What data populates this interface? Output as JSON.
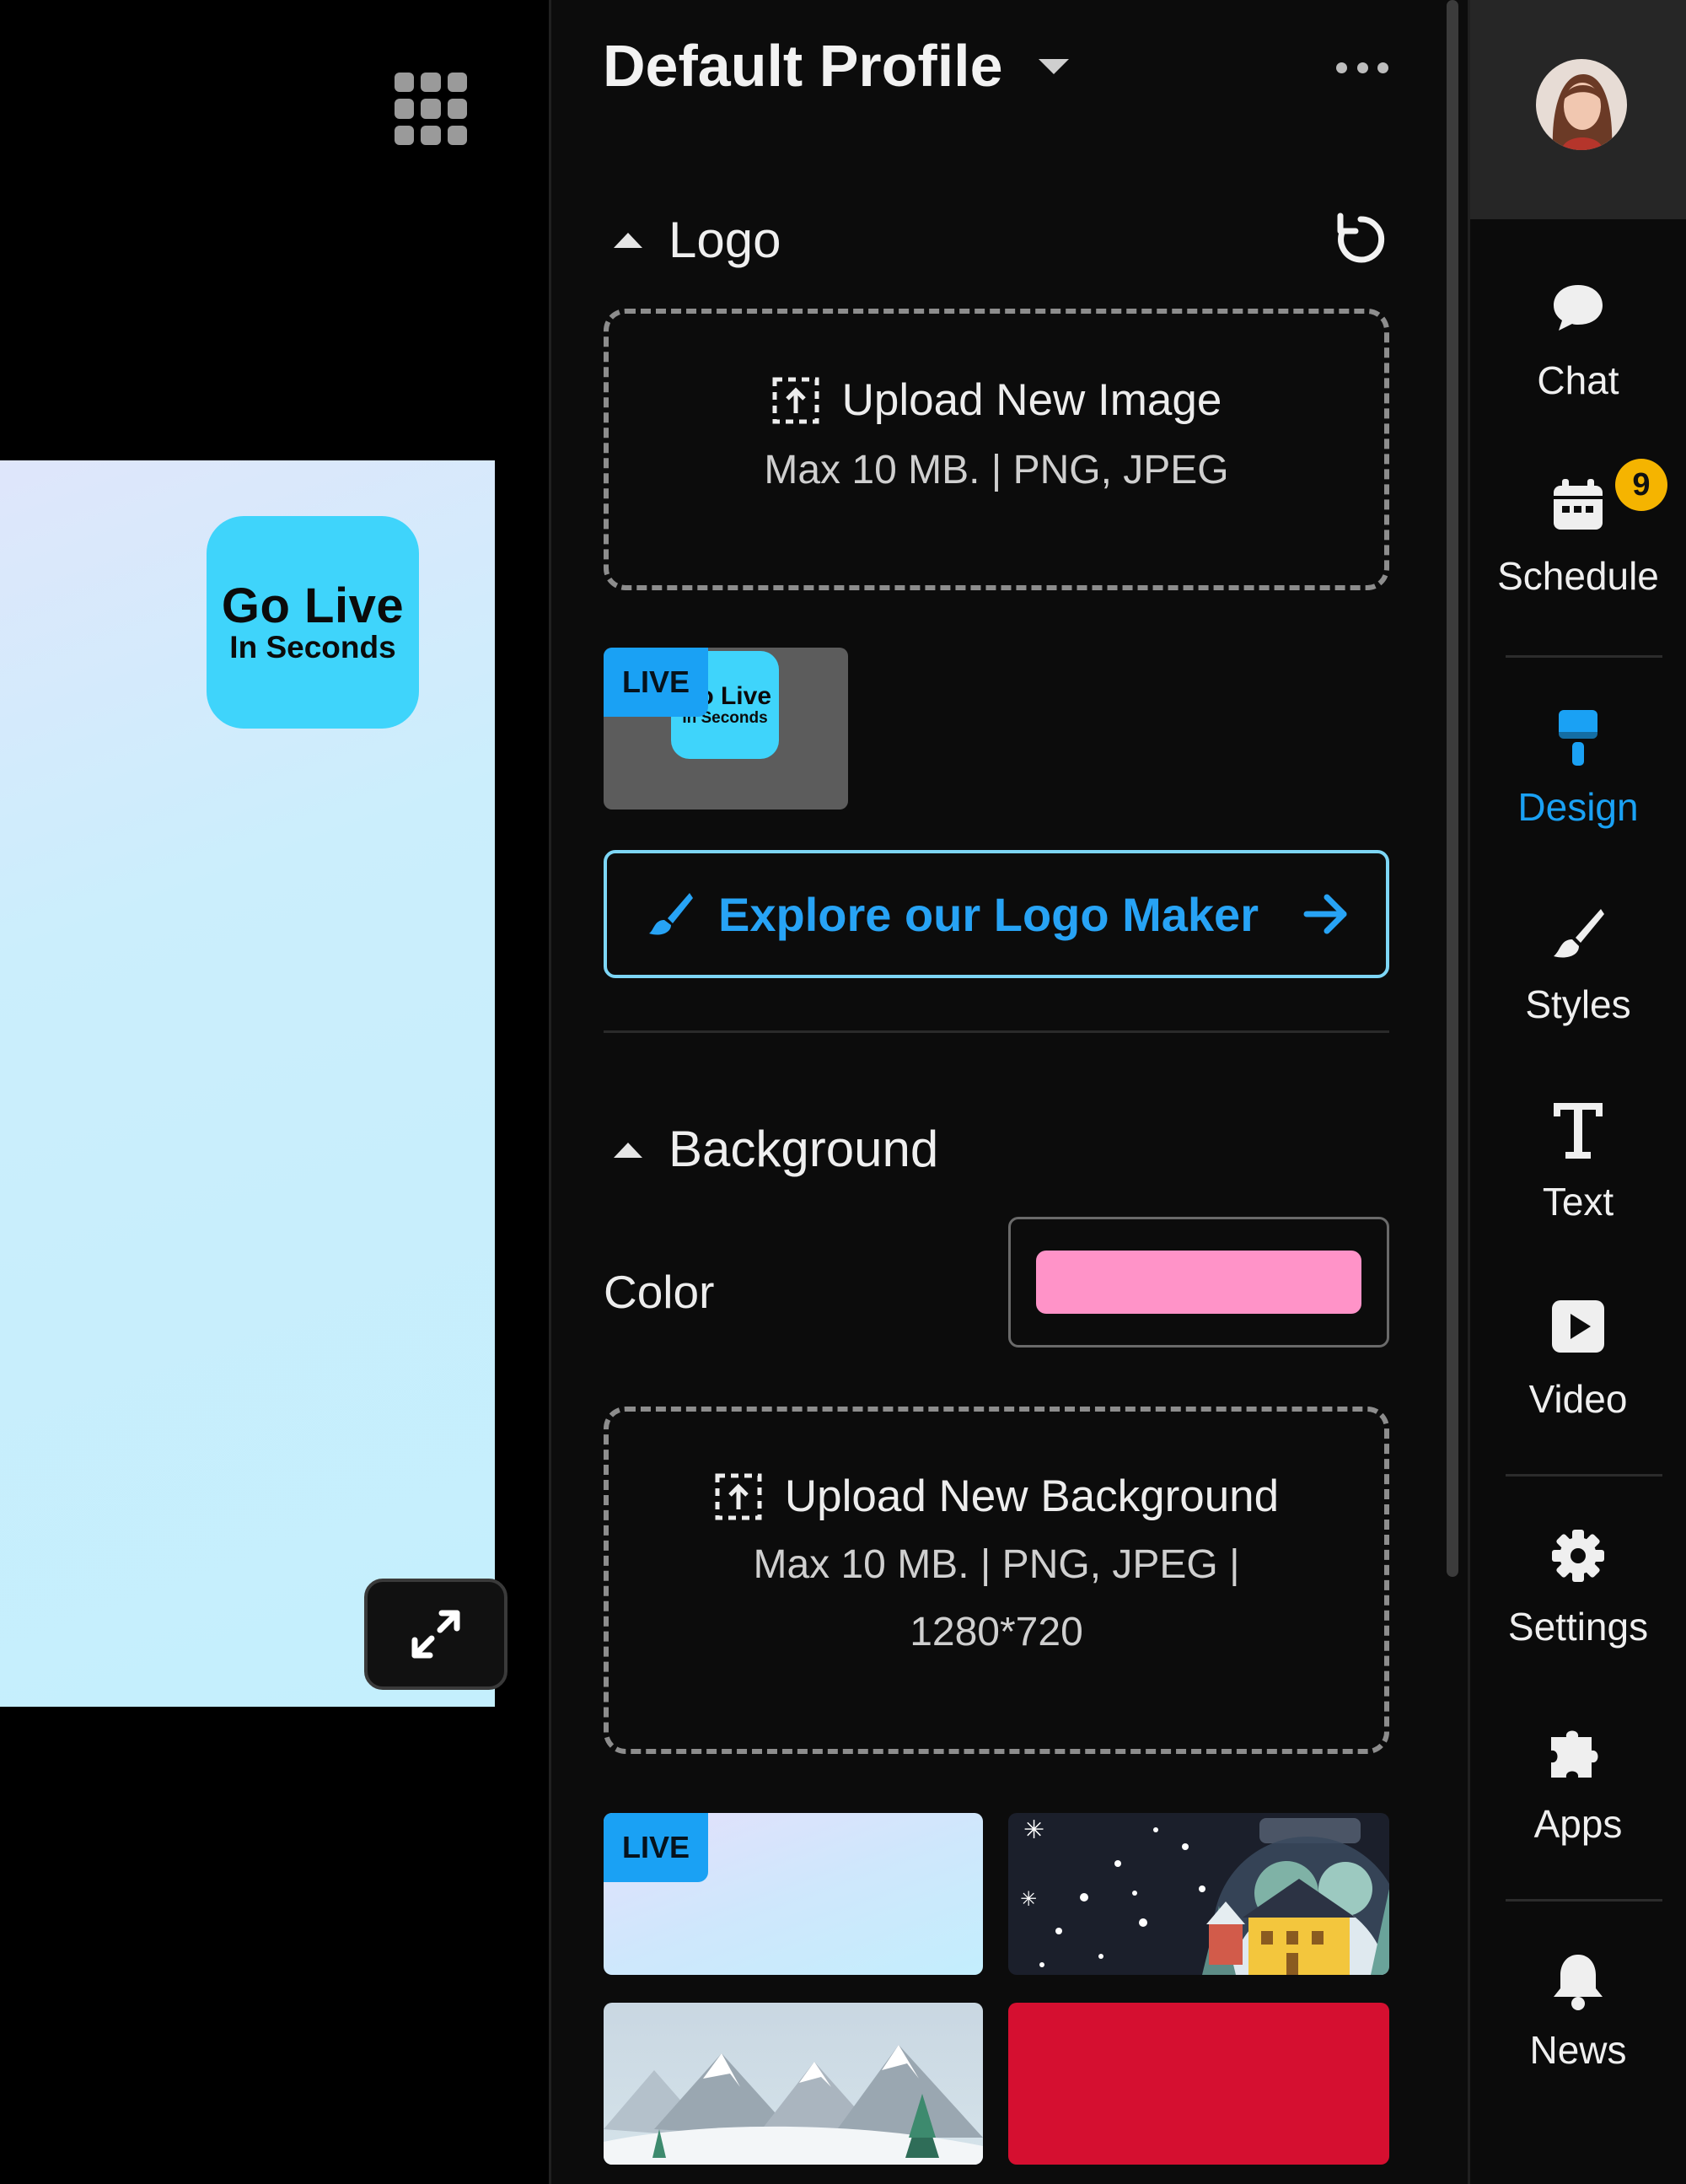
{
  "panel": {
    "title": "Default Profile"
  },
  "logo_section": {
    "title": "Logo",
    "upload": {
      "title": "Upload New Image",
      "subtitle": "Max 10 MB. | PNG, JPEG"
    },
    "current_logo": {
      "badge": "LIVE",
      "line1": "Go Live",
      "line2": "In Seconds"
    },
    "logo_maker_label": "Explore our Logo Maker"
  },
  "background_section": {
    "title": "Background",
    "color_label": "Color",
    "color_value": "#ff93c8",
    "upload": {
      "title": "Upload New Background",
      "subtitle_line1": "Max 10 MB. | PNG, JPEG |",
      "subtitle_line2": "1280*720"
    },
    "thumbnails": [
      {
        "name": "gradient",
        "badge": "LIVE"
      },
      {
        "name": "snow-globe"
      },
      {
        "name": "snowy-mountains"
      },
      {
        "name": "red",
        "color": "#d50f30"
      }
    ]
  },
  "preview": {
    "logo_line1": "Go Live",
    "logo_line2": "In Seconds"
  },
  "nav": {
    "items": [
      {
        "label": "Chat",
        "icon": "chat-icon"
      },
      {
        "label": "Schedule",
        "icon": "calendar-icon",
        "badge": "9"
      },
      {
        "label": "Design",
        "icon": "paint-roller-icon",
        "active": true
      },
      {
        "label": "Styles",
        "icon": "brush-icon"
      },
      {
        "label": "Text",
        "icon": "text-icon"
      },
      {
        "label": "Video",
        "icon": "video-icon"
      },
      {
        "label": "Settings",
        "icon": "gear-icon"
      },
      {
        "label": "Apps",
        "icon": "puzzle-icon"
      },
      {
        "label": "News",
        "icon": "bell-icon"
      }
    ]
  },
  "colors": {
    "accent": "#1aa1f4",
    "badge": "#f5b400",
    "logo_bg": "#3fd4fb"
  }
}
